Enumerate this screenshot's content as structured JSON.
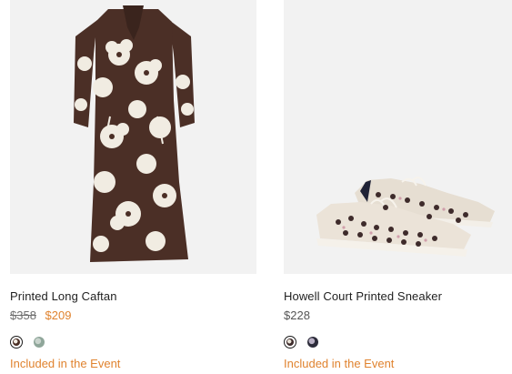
{
  "products": [
    {
      "name": "Printed Long Caftan",
      "price_original": "$358",
      "price_sale": "$209",
      "swatches": [
        {
          "color": "#4a2e24",
          "accent": "#f1ece2",
          "selected": true
        },
        {
          "color": "#8fa69a",
          "accent": "#c9d4cd",
          "selected": false
        }
      ],
      "event_label": "Included in the Event",
      "image_icon": "caftan-dress-image"
    },
    {
      "name": "Howell Court Printed Sneaker",
      "price": "$228",
      "swatches": [
        {
          "color": "#3d2b2b",
          "accent": "#e9e2d6",
          "selected": true
        },
        {
          "color": "#2c2c3a",
          "accent": "#b8b0c4",
          "selected": false
        }
      ],
      "event_label": "Included in the Event",
      "image_icon": "sneaker-pair-image"
    }
  ],
  "colors": {
    "sale": "#e0832f",
    "event": "#e0832f",
    "image_background": "#f2f2f2"
  }
}
